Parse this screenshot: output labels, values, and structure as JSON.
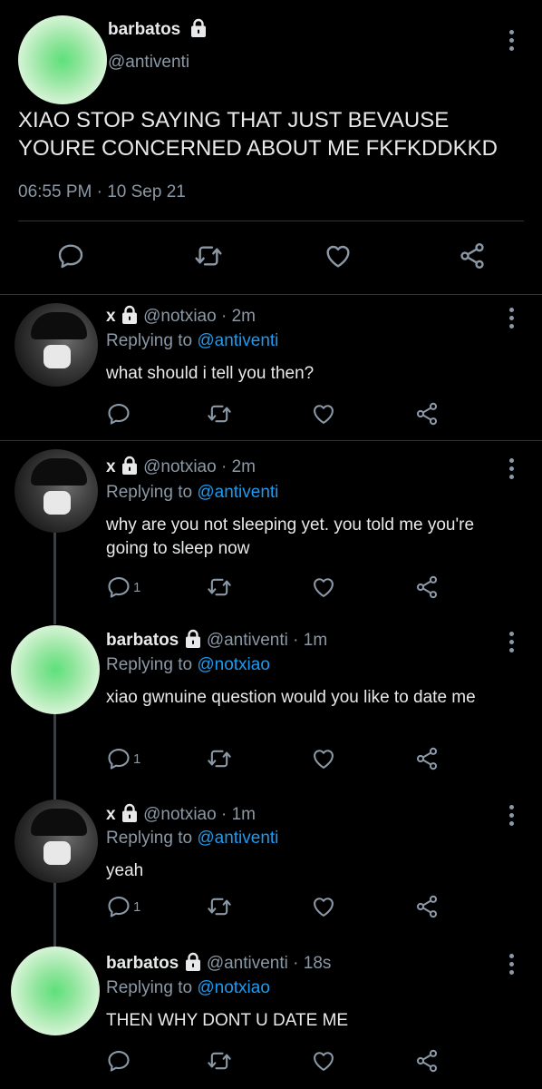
{
  "main_tweet": {
    "display_name": "barbatos",
    "handle": "@antiventi",
    "text": "XIAO STOP SAYING THAT JUST BEVAUSE YOURE CONCERNED ABOUT ME FKFKDDKKD",
    "timestamp": "06:55 PM · 10 Sep 21"
  },
  "replies": [
    {
      "display_name": "x",
      "handle": "@notxiao",
      "time": "· 2m",
      "replying_prefix": "Replying to",
      "replying_to": "@antiventi",
      "text": "what should i tell you then?",
      "reply_count": ""
    },
    {
      "display_name": "x",
      "handle": "@notxiao",
      "time": "· 2m",
      "replying_prefix": "Replying to",
      "replying_to": "@antiventi",
      "text": "why are you not sleeping yet. you told me you're going to sleep now",
      "reply_count": "1"
    },
    {
      "display_name": "barbatos",
      "handle": "@antiventi",
      "time": "· 1m",
      "replying_prefix": "Replying to",
      "replying_to": "@notxiao",
      "text": "xiao gwnuine question would you like to date me",
      "reply_count": "1"
    },
    {
      "display_name": "x",
      "handle": "@notxiao",
      "time": "· 1m",
      "replying_prefix": "Replying to",
      "replying_to": "@antiventi",
      "text": "yeah",
      "reply_count": "1"
    },
    {
      "display_name": "barbatos",
      "handle": "@antiventi",
      "time": "· 18s",
      "replying_prefix": "Replying to",
      "replying_to": "@notxiao",
      "text": "THEN WHY DONT U DATE ME",
      "reply_count": ""
    }
  ],
  "icons": {
    "reply": "reply-icon",
    "retweet": "retweet-icon",
    "like": "like-icon",
    "share": "share-icon",
    "lock": "lock-icon",
    "more": "more-options-icon"
  },
  "colors": {
    "background": "#000000",
    "text": "#e7e9ea",
    "secondary": "#8b98a5",
    "link": "#1d9bf0",
    "divider": "#2f3336"
  }
}
